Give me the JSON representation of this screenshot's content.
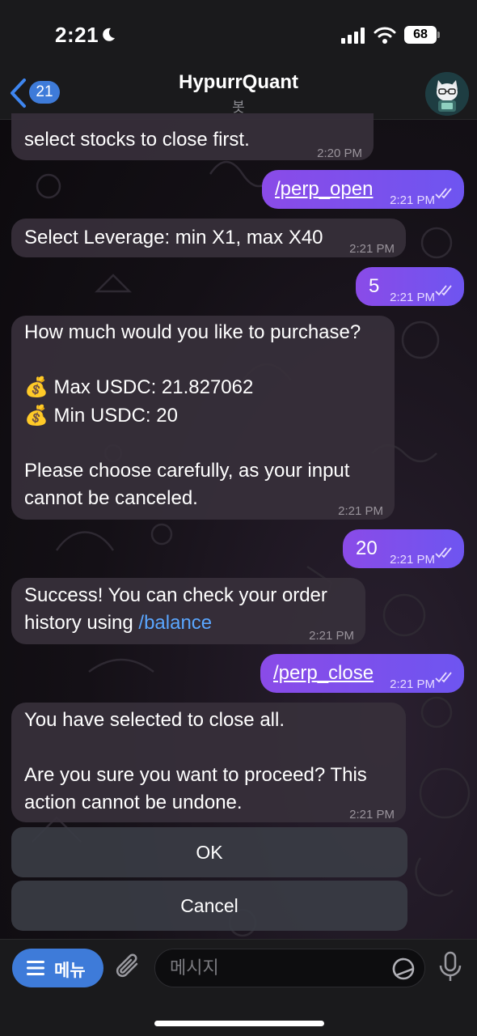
{
  "status_bar": {
    "time": "2:21",
    "battery": "68"
  },
  "header": {
    "back_count": "21",
    "title": "HypurrQuant",
    "subtitle": "봇"
  },
  "messages": [
    {
      "dir": "in",
      "lines": [
        "select stocks to close first."
      ],
      "time": "2:20 PM"
    },
    {
      "dir": "out",
      "text": "/perp_open",
      "time": "2:21 PM"
    },
    {
      "dir": "in",
      "lines": [
        "Select Leverage: min X1, max X40"
      ],
      "time": "2:21 PM"
    },
    {
      "dir": "out",
      "text": "5",
      "time": "2:21 PM"
    },
    {
      "dir": "in",
      "lines": [
        "How much would you like to purchase?",
        "💰 Max USDC: 21.827062",
        "💰 Min USDC: 20",
        "Please choose carefully, as your input",
        "cannot be canceled."
      ],
      "time": "2:21 PM"
    },
    {
      "dir": "out",
      "text": "20",
      "time": "2:21 PM"
    },
    {
      "dir": "in",
      "lines": [
        "Success! You can check your order",
        "history using ",
        "/balance"
      ],
      "time": "2:21 PM"
    },
    {
      "dir": "out",
      "text": "/perp_close",
      "time": "2:21 PM"
    },
    {
      "dir": "in",
      "lines": [
        "You have selected to close all.",
        "Are you sure you want to proceed? This",
        "action cannot be undone."
      ],
      "time": "2:21 PM"
    }
  ],
  "keyboard": {
    "ok_label": "OK",
    "cancel_label": "Cancel"
  },
  "input_bar": {
    "menu_label": "메뉴",
    "placeholder": "메시지"
  },
  "colors": {
    "accent": "#3e7bd9",
    "out_bubble_start": "#8a4be8",
    "out_bubble_end": "#6e55f0",
    "link": "#5aa6ff"
  }
}
